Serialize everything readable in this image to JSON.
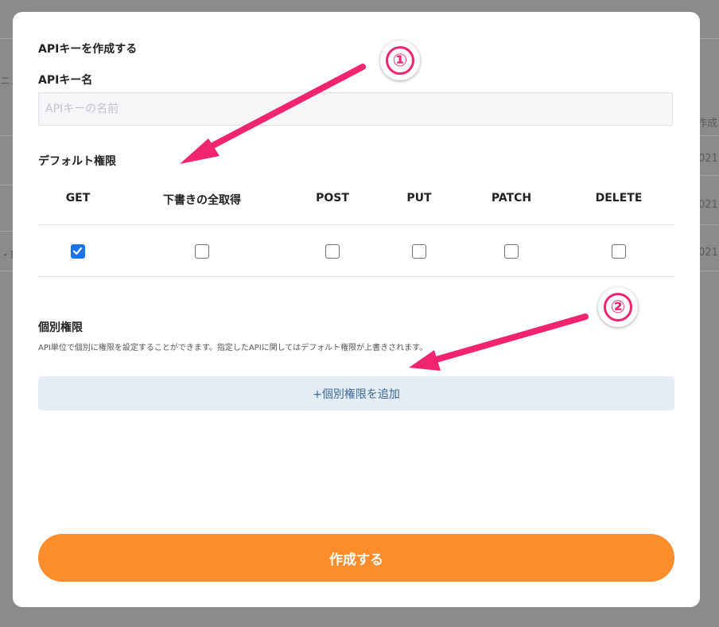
{
  "background": {
    "left_fragments": [
      "ニス",
      "・F"
    ],
    "right_header": "作成日",
    "right_values": [
      "021",
      "021",
      "021"
    ]
  },
  "modal": {
    "title": "APIキーを作成する",
    "key_name_label": "APIキー名",
    "key_name_input": {
      "value": "",
      "placeholder": "APIキーの名前"
    },
    "default_permissions": {
      "label": "デフォルト権限",
      "columns": [
        {
          "label": "GET",
          "checked": true
        },
        {
          "label": "下書きの全取得",
          "checked": false
        },
        {
          "label": "POST",
          "checked": false
        },
        {
          "label": "PUT",
          "checked": false
        },
        {
          "label": "PATCH",
          "checked": false
        },
        {
          "label": "DELETE",
          "checked": false
        }
      ]
    },
    "individual_permissions": {
      "label": "個別権限",
      "description": "API単位で個別に権限を設定することができます。指定したAPIに関してはデフォルト権限が上書きされます。",
      "add_button_label": "+個別権限を追加"
    },
    "create_button_label": "作成する"
  },
  "annotations": {
    "badge_1": "①",
    "badge_2": "②",
    "color": "#f0246f"
  },
  "colors": {
    "accent_orange": "#fd8c2a",
    "checkbox_blue": "#1a73e8",
    "add_button_bg": "#e4ecf6"
  }
}
